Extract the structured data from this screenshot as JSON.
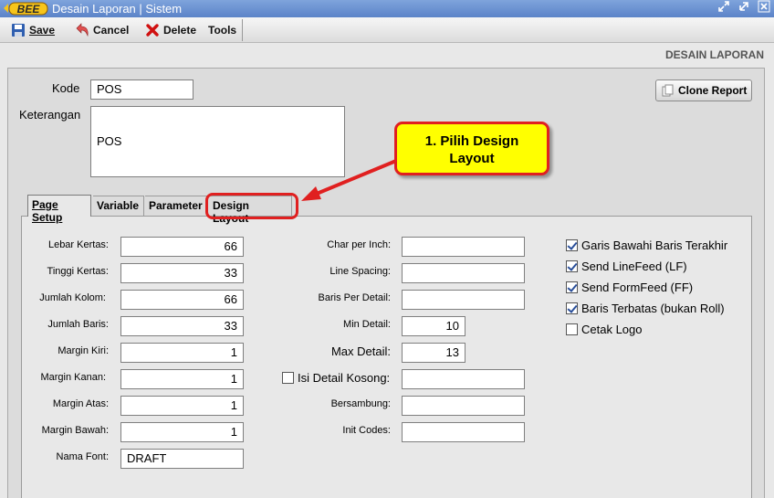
{
  "window": {
    "logo_text": "BEE",
    "title": "Desain Laporan | Sistem",
    "controls": [
      "restore",
      "maximize",
      "close"
    ]
  },
  "toolbar": {
    "save": "Save",
    "cancel": "Cancel",
    "delete": "Delete",
    "tools": "Tools"
  },
  "header": {
    "title": "DESAIN LAPORAN"
  },
  "form": {
    "kode_label": "Kode",
    "kode_value": "POS",
    "keterangan_label": "Keterangan",
    "keterangan_value": "POS",
    "clone_button": "Clone Report"
  },
  "tabs": [
    {
      "label": "Page Setup",
      "active": true
    },
    {
      "label": "Variable",
      "active": false
    },
    {
      "label": "Parameter",
      "active": false
    },
    {
      "label": "Design Layout",
      "active": false
    }
  ],
  "page_setup": {
    "lebar_kertas": {
      "label": "Lebar Kertas:",
      "value": "66"
    },
    "tinggi_kertas": {
      "label": "Tinggi Kertas:",
      "value": "33"
    },
    "jumlah_kolom": {
      "label": "Jumlah Kolom:",
      "value": "66"
    },
    "jumlah_baris": {
      "label": "Jumlah Baris:",
      "value": "33"
    },
    "margin_kiri": {
      "label": "Margin Kiri:",
      "value": "1"
    },
    "margin_kanan": {
      "label": "Margin Kanan:",
      "value": "1"
    },
    "margin_atas": {
      "label": "Margin Atas:",
      "value": "1"
    },
    "margin_bawah": {
      "label": "Margin Bawah:",
      "value": "1"
    },
    "nama_font": {
      "label": "Nama Font:",
      "value": "DRAFT"
    },
    "char_per_inch": {
      "label": "Char per Inch:",
      "value": ""
    },
    "line_spacing": {
      "label": "Line Spacing:",
      "value": ""
    },
    "baris_per_detail": {
      "label": "Baris Per Detail:",
      "value": ""
    },
    "min_detail": {
      "label": "Min Detail:",
      "value": "10"
    },
    "max_detail": {
      "label": "Max Detail:",
      "value": "13"
    },
    "isi_detail_kosong": {
      "label": "Isi Detail Kosong:",
      "checked": false,
      "value": ""
    },
    "bersambung": {
      "label": "Bersambung:",
      "value": ""
    },
    "init_codes": {
      "label": "Init Codes:",
      "value": ""
    }
  },
  "options": [
    {
      "label": "Garis Bawahi Baris Terakhir",
      "checked": true
    },
    {
      "label": "Send LineFeed (LF)",
      "checked": true
    },
    {
      "label": "Send FormFeed (FF)",
      "checked": true
    },
    {
      "label": "Baris Terbatas (bukan Roll)",
      "checked": true
    },
    {
      "label": "Cetak Logo",
      "checked": false
    }
  ],
  "annotation": {
    "text_line1": "1. Pilih Design",
    "text_line2": "Layout",
    "color": "#ffff00",
    "border_color": "#e02020"
  }
}
